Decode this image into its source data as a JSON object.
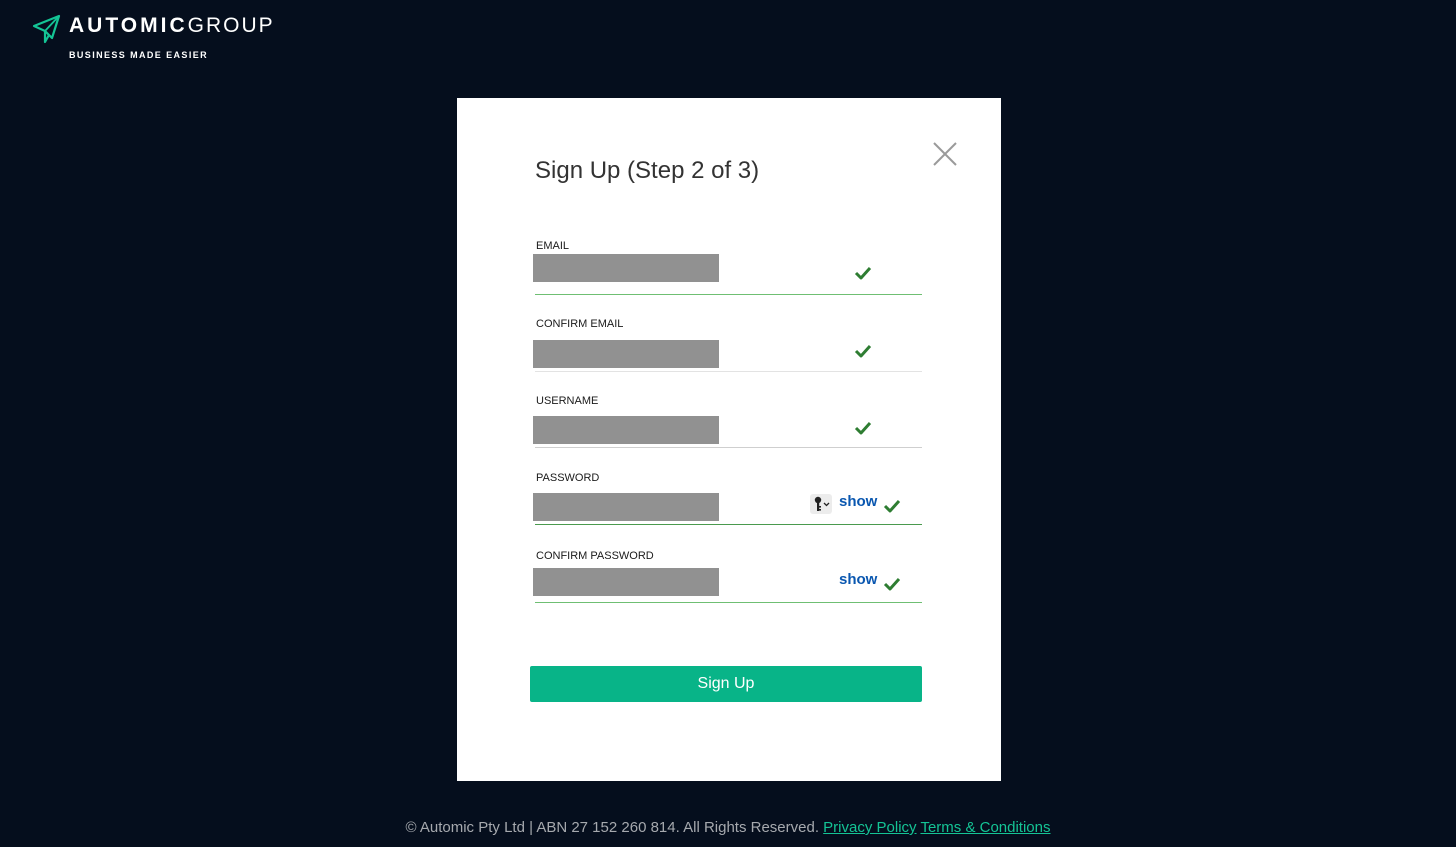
{
  "brand": {
    "name_bold": "AUTOMIC",
    "name_light": "GROUP",
    "tagline": "BUSINESS MADE EASIER",
    "logo_icon": "paper-plane-logo-icon",
    "accent_color": "#14c495"
  },
  "modal": {
    "title": "Sign Up (Step 2 of 3)",
    "close_icon": "close-icon",
    "fields": [
      {
        "label": "EMAIL",
        "value": "",
        "valid": true
      },
      {
        "label": "CONFIRM EMAIL",
        "value": "",
        "valid": true
      },
      {
        "label": "USERNAME",
        "value": "",
        "valid": true
      },
      {
        "label": "PASSWORD",
        "value": "",
        "valid": true,
        "show_label": "show",
        "key_icon": "password-manager-key-icon"
      },
      {
        "label": "CONFIRM PASSWORD",
        "value": "",
        "valid": true,
        "show_label": "show"
      }
    ],
    "submit_label": "Sign Up",
    "submit_color": "#08b488",
    "valid_color": "#2e7d32",
    "link_color": "#0a57b0"
  },
  "footer": {
    "copyright": "© Automic Pty Ltd | ABN 27 152 260 814. All Rights Reserved.",
    "privacy_label": "Privacy Policy",
    "terms_label": "Terms & Conditions"
  }
}
